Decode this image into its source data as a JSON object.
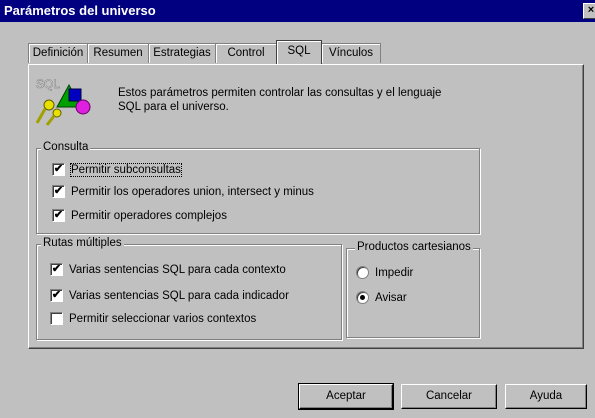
{
  "window": {
    "title": "Parámetros del universo",
    "close_glyph": "×"
  },
  "tabs": [
    {
      "label": "Definición"
    },
    {
      "label": "Resumen"
    },
    {
      "label": "Estrategias"
    },
    {
      "label": "Control"
    },
    {
      "label": "SQL",
      "active": true
    },
    {
      "label": "Vínculos"
    }
  ],
  "sql_panel": {
    "icon_text": "SQL",
    "intro_line1": "Estos parámetros permiten controlar las consultas y el lenguaje",
    "intro_line2": "SQL para el universo.",
    "consulta": {
      "label": "Consulta",
      "options": [
        {
          "label": "Permitir subconsultas",
          "checked": true
        },
        {
          "label": "Permitir los operadores union, intersect y minus",
          "checked": true
        },
        {
          "label": "Permitir operadores complejos",
          "checked": true
        }
      ]
    },
    "rutas": {
      "label": "Rutas múltiples",
      "options": [
        {
          "label": "Varias sentencias SQL para cada contexto",
          "checked": true
        },
        {
          "label": "Varias sentencias SQL para cada indicador",
          "checked": true
        },
        {
          "label": "Permitir seleccionar varios contextos",
          "checked": false
        }
      ]
    },
    "productos": {
      "label": "Productos cartesianos",
      "options": [
        {
          "label": "Impedir",
          "selected": false
        },
        {
          "label": "Avisar",
          "selected": true
        }
      ]
    },
    "check_glyph": "✔"
  },
  "buttons": {
    "accept": "Aceptar",
    "cancel": "Cancelar",
    "help": "Ayuda"
  }
}
